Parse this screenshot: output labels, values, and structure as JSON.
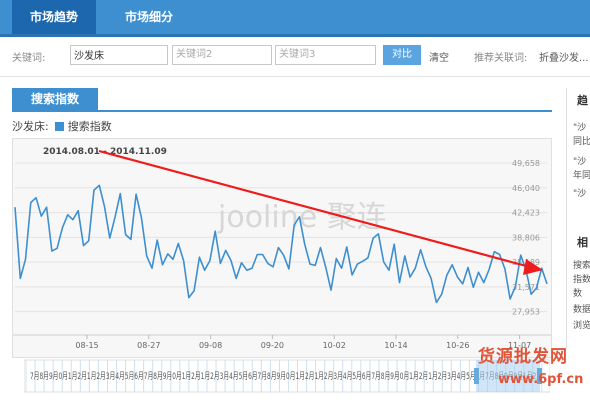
{
  "tabs": [
    {
      "label": "市场趋势",
      "active": true
    },
    {
      "label": "市场细分",
      "active": false
    }
  ],
  "search": {
    "keyword_label": "关键词:",
    "keyword1_value": "沙发床",
    "keyword2_placeholder": "关键词2",
    "keyword3_placeholder": "关键词3",
    "compare_label": "对比",
    "clear_label": "清空",
    "recommend_label": "推荐关联词:",
    "recommend_value": "折叠沙发..."
  },
  "section": {
    "title": "搜索指数",
    "keyword_prefix": "沙发床:",
    "legend_label": "搜索指数"
  },
  "chart_data": {
    "type": "line",
    "title": "",
    "date_range": "2014.08.01 - 2014.11.09",
    "x_ticks": [
      "08-15",
      "08-27",
      "09-08",
      "09-20",
      "10-02",
      "10-14",
      "10-26",
      "11-07"
    ],
    "y_ticks": [
      "49,658",
      "46,040",
      "42,423",
      "38,806",
      "35,189",
      "31,571",
      "27,953"
    ],
    "ylim": [
      26000,
      52000
    ],
    "grid": true,
    "legend": "top-left",
    "line_color": "#3d8fd0",
    "trend_arrow_color": "#ee1c1c",
    "series": [
      {
        "name": "搜索指数",
        "values": [
          43200,
          32800,
          35600,
          43900,
          44600,
          41900,
          43200,
          36800,
          37200,
          40200,
          42100,
          41400,
          42700,
          37600,
          38300,
          45700,
          46400,
          43300,
          38700,
          41800,
          45200,
          39200,
          38500,
          45100,
          41700,
          36100,
          34300,
          38400,
          34800,
          36400,
          35600,
          37900,
          35400,
          30000,
          31000,
          35900,
          34000,
          35400,
          39700,
          35000,
          36900,
          35400,
          32800,
          35100,
          34000,
          34300,
          36300,
          36300,
          35000,
          34500,
          37300,
          36200,
          34200,
          40600,
          41800,
          37800,
          34900,
          34700,
          37300,
          34400,
          31100,
          35700,
          34300,
          37400,
          33300,
          34900,
          35300,
          35800,
          38700,
          39300,
          35200,
          34000,
          37800,
          32200,
          36100,
          33000,
          34300,
          37000,
          34500,
          32800,
          29300,
          30500,
          33300,
          34800,
          33000,
          32000,
          34400,
          31500,
          33700,
          32200,
          34100,
          36700,
          36300,
          34200,
          29800,
          31600,
          36200,
          34100,
          30500,
          31400,
          34300,
          32000
        ]
      }
    ]
  },
  "timeline_label_pattern": "7月8月9月0月1月2月1月2月3月4月5月6月7月8月9月0月1月2月1月2月3月4月5月6月7月8月9月0月1月2月1月2月3月4月5月6月7月8月9月0月1月2月1月2月3月4月5月6月7月8月9月0月1月2月",
  "right_panel": {
    "head1": "趋",
    "lines1": [
      "\"沙",
      "同比",
      "\"沙",
      "年同",
      "\"沙"
    ],
    "head2": "相",
    "lines2": [
      "搜索",
      "指数",
      "数",
      "数据",
      "浏览"
    ]
  },
  "watermark": {
    "line1": "货源批发网",
    "line2": "www.6pf.cn"
  },
  "brand_watermark": "jooline 聚连"
}
